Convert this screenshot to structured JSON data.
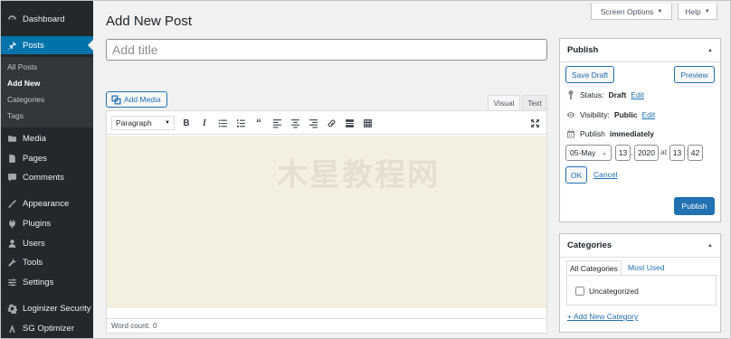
{
  "sidebar": {
    "items": [
      {
        "label": "Dashboard",
        "icon": "dashboard-icon"
      },
      {
        "label": "Posts",
        "icon": "pin-icon"
      },
      {
        "label": "Media",
        "icon": "media-icon"
      },
      {
        "label": "Pages",
        "icon": "pages-icon"
      },
      {
        "label": "Comments",
        "icon": "comment-icon"
      },
      {
        "label": "Appearance",
        "icon": "brush-icon"
      },
      {
        "label": "Plugins",
        "icon": "plugin-icon"
      },
      {
        "label": "Users",
        "icon": "user-icon"
      },
      {
        "label": "Tools",
        "icon": "wrench-icon"
      },
      {
        "label": "Settings",
        "icon": "settings-icon"
      },
      {
        "label": "Loginizer Security",
        "icon": "gear-icon"
      },
      {
        "label": "SG Optimizer",
        "icon": "optimizer-icon"
      }
    ],
    "submenu": [
      "All Posts",
      "Add New",
      "Categories",
      "Tags"
    ]
  },
  "header": {
    "screen_options": "Screen Options",
    "help": "Help",
    "title": "Add New Post"
  },
  "editor": {
    "title_placeholder": "Add title",
    "add_media": "Add Media",
    "tab_visual": "Visual",
    "tab_text": "Text",
    "format": "Paragraph",
    "word_count_label": "Word count:",
    "word_count": "0"
  },
  "watermark": "木星教程网",
  "publish": {
    "heading": "Publish",
    "save_draft": "Save Draft",
    "preview": "Preview",
    "status_label": "Status:",
    "status_value": "Draft",
    "visibility_label": "Visibility:",
    "visibility_value": "Public",
    "edit": "Edit",
    "publish_label": "Publish",
    "publish_value": "immediately",
    "month": "05-May",
    "day": "13",
    "year": "2020",
    "at": "at",
    "hour": "13",
    "minute": "42",
    "ok": "OK",
    "cancel": "Cancel",
    "publish_button": "Publish"
  },
  "categories": {
    "heading": "Categories",
    "tab_all": "All Categories",
    "tab_most_used": "Most Used",
    "items": [
      "Uncategorized"
    ],
    "add_new": "+ Add New Category"
  },
  "colors": {
    "accent": "#0073aa",
    "sidebar_bg": "#23282d",
    "editor_bg": "#f4f0e0"
  }
}
